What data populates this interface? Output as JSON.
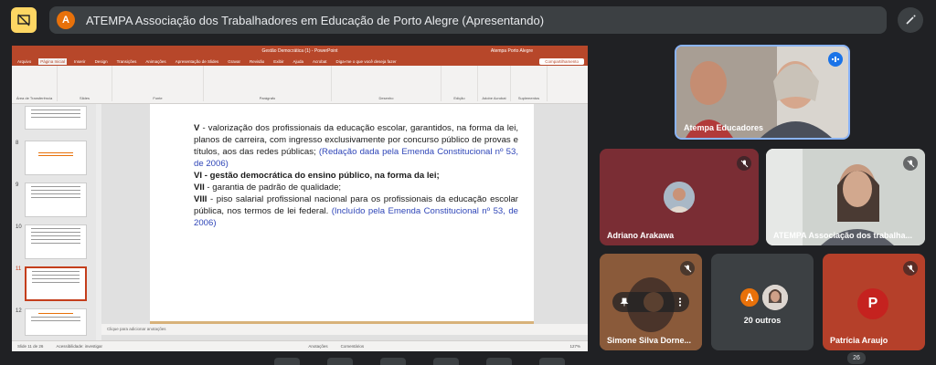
{
  "meeting": {
    "avatar_letter": "A",
    "title": "ATEMPA Associação dos Trabalhadores em Educação de Porto Alegre (Apresentando)"
  },
  "ppt": {
    "filename": "Gestão Democrática (1) - PowerPoint",
    "user": "Atempa Porto Alegre",
    "tabs": [
      "Arquivo",
      "Página Inicial",
      "Inserir",
      "Design",
      "Transições",
      "Animações",
      "Apresentação de Slides",
      "Gravar",
      "Revisão",
      "Exibir",
      "Ajuda",
      "Acrobat"
    ],
    "active_tab_index": 1,
    "search_hint": "Diga-me o que você deseja fazer",
    "share_label": "Compartilhamento",
    "ribbon_groups": [
      "Área de Transferência",
      "Slides",
      "Fonte",
      "Parágrafo",
      "Desenho",
      "Edição",
      "Adobe Acrobat",
      "Suplementos"
    ],
    "thumb_numbers": [
      "8",
      "9",
      "10",
      "11",
      "12"
    ],
    "notes_placeholder": "Clique para adicionar anotações",
    "status": {
      "slide_count": "Slide 11 de 26",
      "accessibility": "Acessibilidade: investigar",
      "notes": "Anotações",
      "comments": "Comentários",
      "zoom": "127%"
    }
  },
  "slide": {
    "item5_numeral": "V",
    "item5_text": "- valorização dos profissionais da educação escolar, garantidos, na forma da lei, planos de carreira, com ingresso exclusivamente por concurso público de provas e títulos, aos das redes públicas;",
    "item5_ref": "(Redação dada pela Emenda Constitucional nº 53, de 2006)",
    "item6": "VI - gestão democrática do ensino público, na forma da lei;",
    "item7_numeral": "VII",
    "item7_text": "- garantia de padrão de qualidade;",
    "item8_numeral": "VIII",
    "item8_text": "- piso salarial profissional nacional para os profissionais da educação escolar pública, nos termos de lei federal.",
    "item8_ref": "(Incluído pela Emenda Constitucional nº 53, de 2006)"
  },
  "participants": [
    {
      "name": "Atempa Educadores",
      "mic": "speaking"
    },
    {
      "name": "Adriano Arakawa",
      "mic": "muted"
    },
    {
      "name": "ATEMPA Associação dos trabalha...",
      "mic": "muted"
    },
    {
      "name": "Simone Silva Dorne...",
      "mic": "muted"
    },
    {
      "name": "20 outros",
      "avatar_letter": "A"
    },
    {
      "name": "Patrícia Araujo",
      "avatar_letter": "P",
      "mic": "muted"
    }
  ],
  "participant_count": "26",
  "colors": {
    "meet_bg": "#202124",
    "ppt_accent": "#b7472a",
    "avatar_orange": "#e8710a",
    "patricia_tile": "#b5402a",
    "adriano_tile": "#7a2d34",
    "link_blue": "#2f46b8"
  }
}
